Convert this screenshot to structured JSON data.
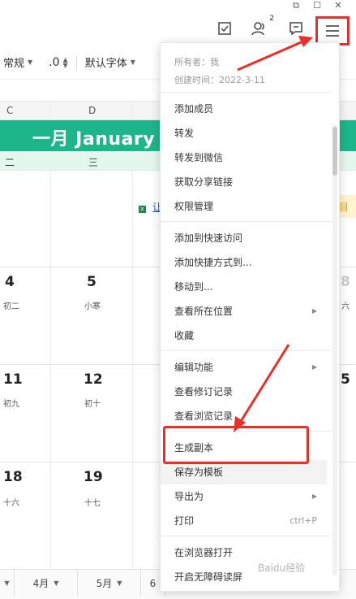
{
  "header": {
    "collab_count": "2"
  },
  "toolbar": {
    "format": "常规",
    "decimal": ".0",
    "font": "默认字体"
  },
  "columns": {
    "c": "C",
    "d": "D"
  },
  "calendar": {
    "banner": "一月 January",
    "weekdays": [
      "二",
      "三"
    ],
    "link_fragment": "让",
    "yellow_fragment": "目",
    "days": [
      {
        "num": "4",
        "sub": "初二"
      },
      {
        "num": "5",
        "sub": "小寒"
      },
      {
        "num": "11",
        "sub": "初九"
      },
      {
        "num": "12",
        "sub": "初十"
      },
      {
        "num": "18",
        "sub": "十六"
      },
      {
        "num": "19",
        "sub": "十七"
      }
    ],
    "right_nums": [
      "8",
      "5"
    ],
    "right_subs": [
      "六"
    ]
  },
  "tabs": [
    "4月",
    "5月",
    "6"
  ],
  "menu": {
    "owner": "所有者：我",
    "created": "创建时间：2022-3-11",
    "items": [
      "添加成员",
      "转发",
      "转发到微信",
      "获取分享链接",
      "权限管理",
      "添加到快速访问",
      "添加快捷方式到...",
      "移动到...",
      "查看所在位置",
      "收藏",
      "编辑功能",
      "查看修订记录",
      "查看浏览记录",
      "生成副本",
      "保存为模板",
      "导出为",
      "打印",
      "在浏览器打开",
      "开启无障碍读屏"
    ],
    "print_shortcut": "ctrl+P"
  },
  "watermark": "Baidu经验",
  "colors": {
    "accent": "#1db58a",
    "highlight": "#e8302a"
  }
}
